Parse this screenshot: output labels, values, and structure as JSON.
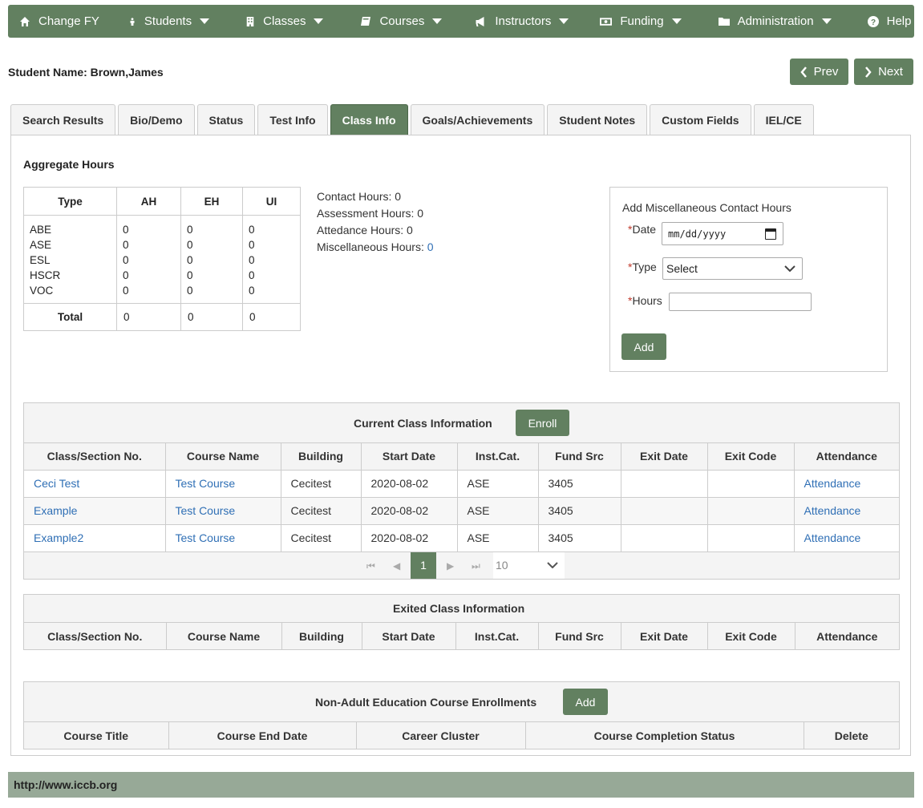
{
  "nav": [
    {
      "label": "Change FY",
      "icon": "home-icon",
      "caret": false
    },
    {
      "label": "Students",
      "icon": "person-icon",
      "caret": true
    },
    {
      "label": "Classes",
      "icon": "building-icon",
      "caret": true
    },
    {
      "label": "Courses",
      "icon": "book-icon",
      "caret": true
    },
    {
      "label": "Instructors",
      "icon": "bullhorn-icon",
      "caret": true
    },
    {
      "label": "Funding",
      "icon": "money-icon",
      "caret": true
    },
    {
      "label": "Administration",
      "icon": "folder-icon",
      "caret": true
    },
    {
      "label": "Help",
      "icon": "question-icon",
      "caret": true
    }
  ],
  "student": {
    "name": "Student Name: Brown,James"
  },
  "pager_buttons": {
    "prev": "Prev",
    "next": "Next"
  },
  "tabs": [
    "Search Results",
    "Bio/Demo",
    "Status",
    "Test Info",
    "Class Info",
    "Goals/Achievements",
    "Student Notes",
    "Custom Fields",
    "IEL/CE"
  ],
  "active_tab": "Class Info",
  "aggregate": {
    "title": "Aggregate Hours",
    "headers": [
      "Type",
      "AH",
      "EH",
      "UI"
    ],
    "types": [
      "ABE",
      "ASE",
      "ESL",
      "HSCR",
      "VOC"
    ],
    "ah": [
      "0",
      "0",
      "0",
      "0",
      "0"
    ],
    "eh": [
      "0",
      "0",
      "0",
      "0",
      "0"
    ],
    "ui": [
      "0",
      "0",
      "0",
      "0",
      "0"
    ],
    "total_label": "Total",
    "totals": [
      "0",
      "0",
      "0"
    ]
  },
  "hours_info": {
    "contact": "Contact Hours: 0",
    "assessment": "Assessment Hours: 0",
    "attendance": "Attedance Hours: 0",
    "misc_label": "Miscellaneous Hours: ",
    "misc_value": "0"
  },
  "misc_form": {
    "title": "Add Miscellaneous Contact Hours",
    "req": "*",
    "date_label": "Date",
    "date_placeholder": "mm/dd/yyyy",
    "type_label": "Type",
    "type_value": "Select",
    "hours_label": "Hours",
    "hours_value": "",
    "add_label": "Add"
  },
  "current_class": {
    "title": "Current Class Information",
    "enroll_label": "Enroll",
    "headers": [
      "Class/Section No.",
      "Course Name",
      "Building",
      "Start Date",
      "Inst.Cat.",
      "Fund Src",
      "Exit Date",
      "Exit Code",
      "Attendance"
    ],
    "rows": [
      [
        "Ceci Test",
        "Test Course",
        "Cecitest",
        "2020-08-02",
        "ASE",
        "3405",
        "",
        "",
        "Attendance"
      ],
      [
        "Example",
        "Test Course",
        "Cecitest",
        "2020-08-02",
        "ASE",
        "3405",
        "",
        "",
        "Attendance"
      ],
      [
        "Example2",
        "Test Course",
        "Cecitest",
        "2020-08-02",
        "ASE",
        "3405",
        "",
        "",
        "Attendance"
      ]
    ],
    "page": "1",
    "page_size": "10"
  },
  "exited_class": {
    "title": "Exited Class Information",
    "headers": [
      "Class/Section No.",
      "Course Name",
      "Building",
      "Start Date",
      "Inst.Cat.",
      "Fund Src",
      "Exit Date",
      "Exit Code",
      "Attendance"
    ]
  },
  "non_adult": {
    "title": "Non-Adult Education Course Enrollments",
    "add_label": "Add",
    "headers": [
      "Course Title",
      "Course End Date",
      "Career Cluster",
      "Course Completion Status",
      "Delete"
    ]
  },
  "footer": {
    "url": "http://www.iccb.org"
  },
  "colors": {
    "accent": "#628060",
    "link": "#2f6fb5",
    "footer": "#97a997"
  }
}
